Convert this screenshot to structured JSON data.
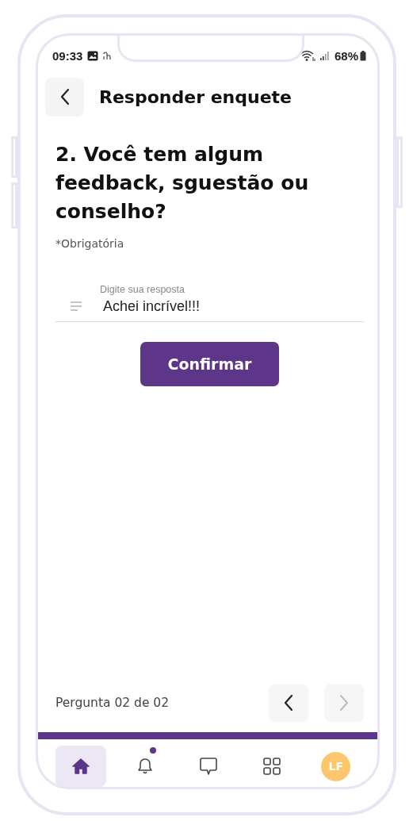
{
  "status_bar": {
    "time": "09:33",
    "battery": "68%"
  },
  "header": {
    "title": "Responder enquete"
  },
  "question": {
    "title": "2. Você tem algum feedback, sguestão ou conselho?",
    "required_note": "*Obrigatória"
  },
  "answer_field": {
    "label": "Digite sua resposta",
    "value": "Achei incrível!!!"
  },
  "confirm_button": {
    "label": "Confirmar"
  },
  "footer": {
    "progress": "Pergunta 02 de 02",
    "previous": {
      "disabled": false
    },
    "next": {
      "disabled": true
    }
  },
  "bottom_nav": [
    {
      "kind": "home",
      "selected": true,
      "badge": false
    },
    {
      "kind": "bell",
      "selected": false,
      "badge": true
    },
    {
      "kind": "chat",
      "selected": false,
      "badge": false
    },
    {
      "kind": "grid",
      "selected": false,
      "badge": false
    },
    {
      "kind": "avatar",
      "selected": false,
      "badge": false,
      "initials": "LF"
    }
  ]
}
